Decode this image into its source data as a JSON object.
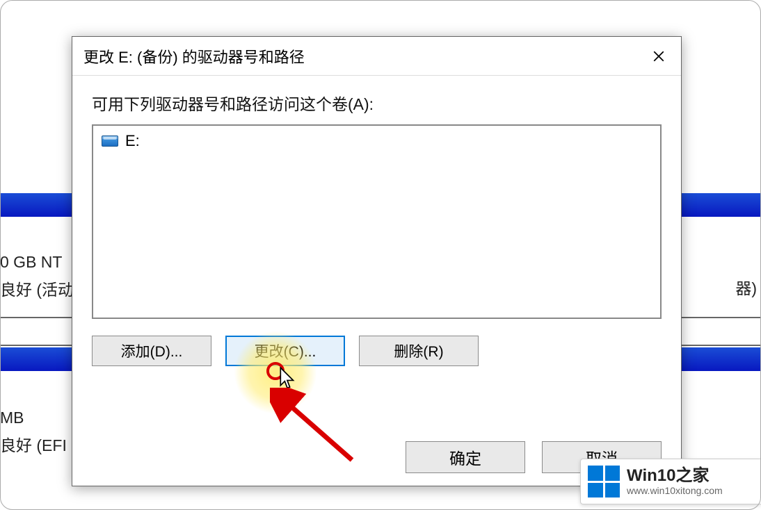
{
  "dialog": {
    "title": "更改 E: (备份) 的驱动器号和路径",
    "prompt": "可用下列驱动器号和路径访问这个卷(A):",
    "items": [
      {
        "icon": "drive-icon",
        "text": "E:"
      }
    ],
    "buttons": {
      "add": "添加(D)...",
      "change": "更改(C)...",
      "remove": "删除(R)"
    },
    "footer": {
      "ok": "确定",
      "cancel": "取消"
    }
  },
  "background": {
    "part_left_line1": "0 GB NT",
    "part_left_line2": "良好 (活动",
    "part_right_line": "器)",
    "efi_line1": "MB",
    "efi_line2": "良好 (EFI 系"
  },
  "watermark": {
    "title": "Win10之家",
    "url": "www.win10xitong.com"
  }
}
